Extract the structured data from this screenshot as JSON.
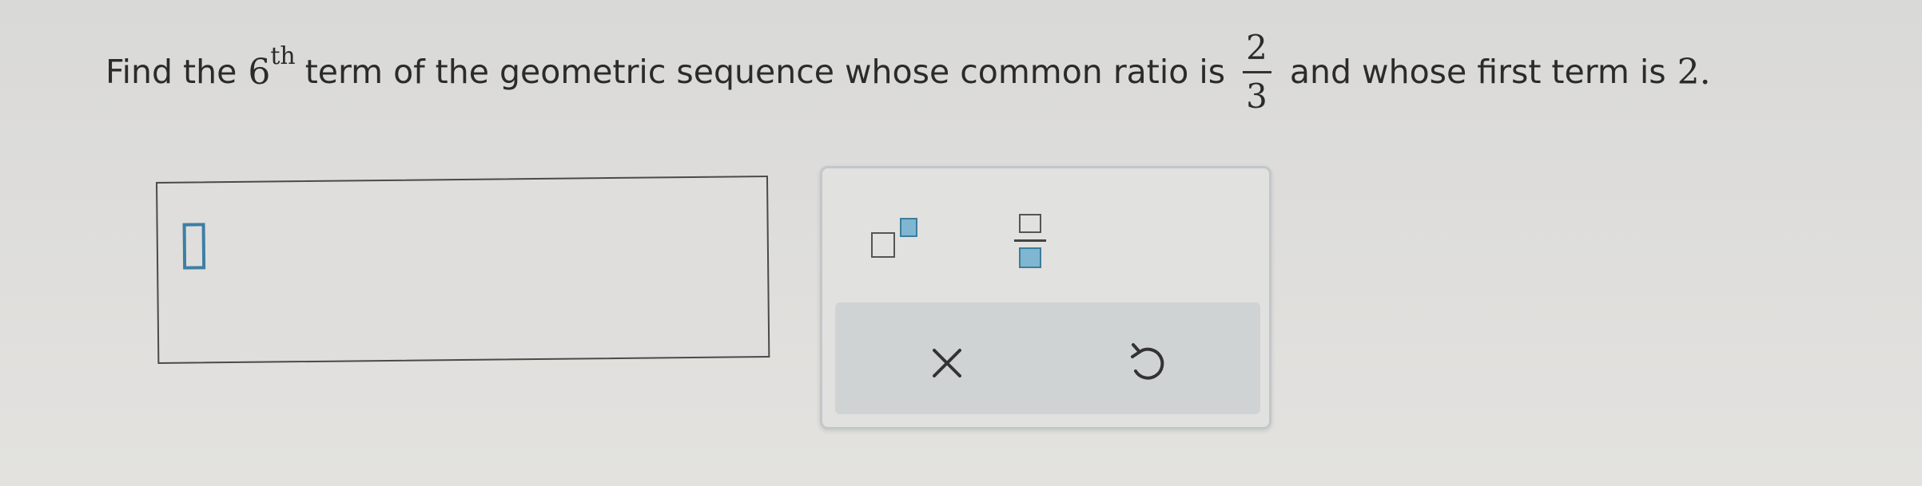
{
  "question": {
    "prefix": "Find the",
    "term_number": "6",
    "term_suffix": "th",
    "middle": "term of the geometric sequence whose common ratio is",
    "ratio_numerator": "2",
    "ratio_denominator": "3",
    "after_ratio": "and whose first term is",
    "first_term": "2",
    "end": "."
  },
  "answer": {
    "value": ""
  },
  "keypad": {
    "keys": [
      {
        "name": "exponent-key",
        "icon": "superscript-template-icon"
      },
      {
        "name": "fraction-key",
        "icon": "fraction-template-icon"
      }
    ],
    "actions": [
      {
        "name": "clear-button",
        "icon": "close-icon"
      },
      {
        "name": "undo-button",
        "icon": "undo-icon"
      }
    ]
  },
  "colors": {
    "accent": "#3d7fa5",
    "template_fill": "#7fb6d1",
    "action_bar": "#cfd3d4",
    "background": "#dedddb"
  }
}
